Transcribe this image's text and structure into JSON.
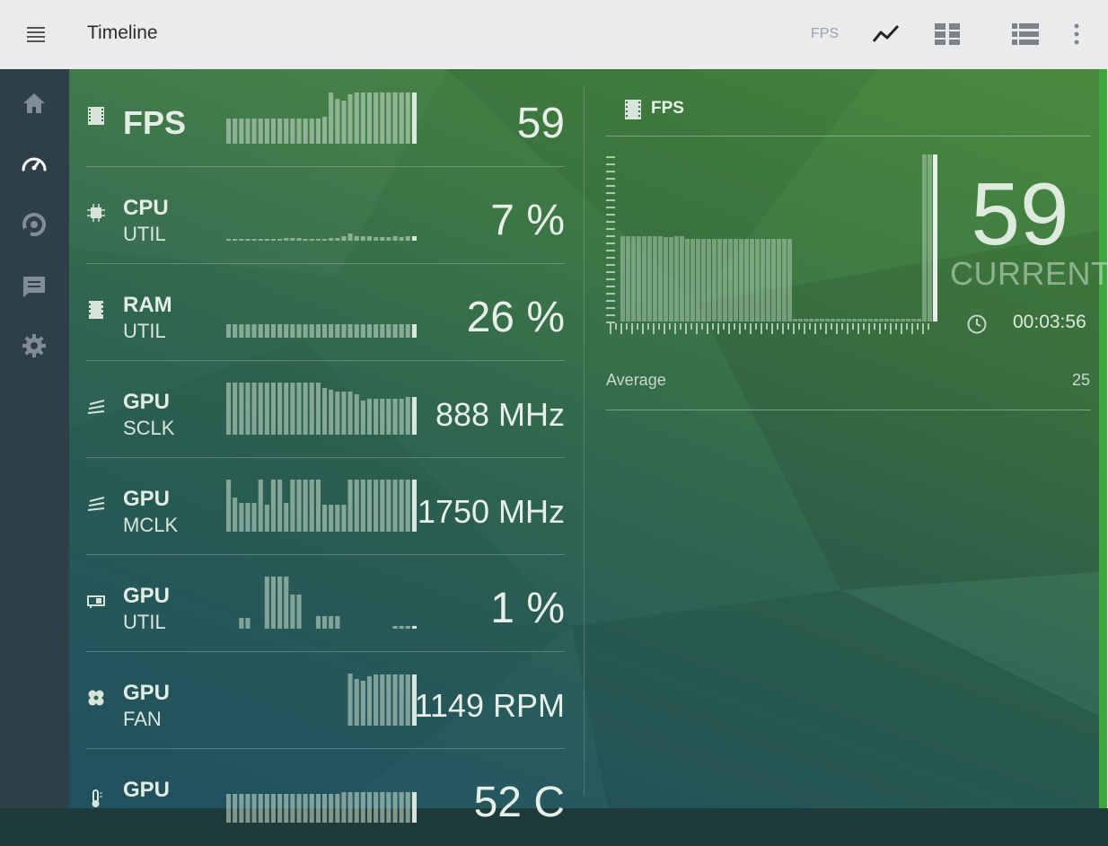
{
  "header": {
    "title": "Timeline",
    "fps_label": "FPS",
    "icons": [
      "hamburger-menu-icon",
      "line-chart-icon",
      "grid-view-icon",
      "list-view-icon",
      "more-vert-icon"
    ]
  },
  "sidebar": {
    "items": [
      "home-icon",
      "speedometer-icon",
      "chart-pie-icon",
      "message-icon",
      "settings-icon"
    ],
    "active": "speedometer-icon"
  },
  "metrics": [
    {
      "l1": "FPS",
      "l2": "",
      "value": "59",
      "icon": "film-icon"
    },
    {
      "l1": "CPU",
      "l2": "UTIL",
      "value": "7 %",
      "icon": "chip-icon"
    },
    {
      "l1": "RAM",
      "l2": "UTIL",
      "value": "26 %",
      "icon": "memory-icon"
    },
    {
      "l1": "GPU",
      "l2": "SCLK",
      "value": "888 MHz",
      "icon": "clock-waves-icon"
    },
    {
      "l1": "GPU",
      "l2": "MCLK",
      "value": "1750 MHz",
      "icon": "clock-waves-icon"
    },
    {
      "l1": "GPU",
      "l2": "UTIL",
      "value": "1 %",
      "icon": "gpu-card-icon"
    },
    {
      "l1": "GPU",
      "l2": "FAN",
      "value": "1149 RPM",
      "icon": "fan-icon"
    },
    {
      "l1": "GPU",
      "l2": "",
      "value": "52 C",
      "icon": "thermometer-icon"
    }
  ],
  "detail": {
    "title": "FPS",
    "current_value": "59",
    "current_label": "CURRENT",
    "timer": "00:03:56",
    "average_label": "Average",
    "average_value": "25"
  },
  "colors": {
    "accent": "#3aa83e",
    "sidebar": "#2f3f48",
    "topbar": "#e9ebec"
  }
}
